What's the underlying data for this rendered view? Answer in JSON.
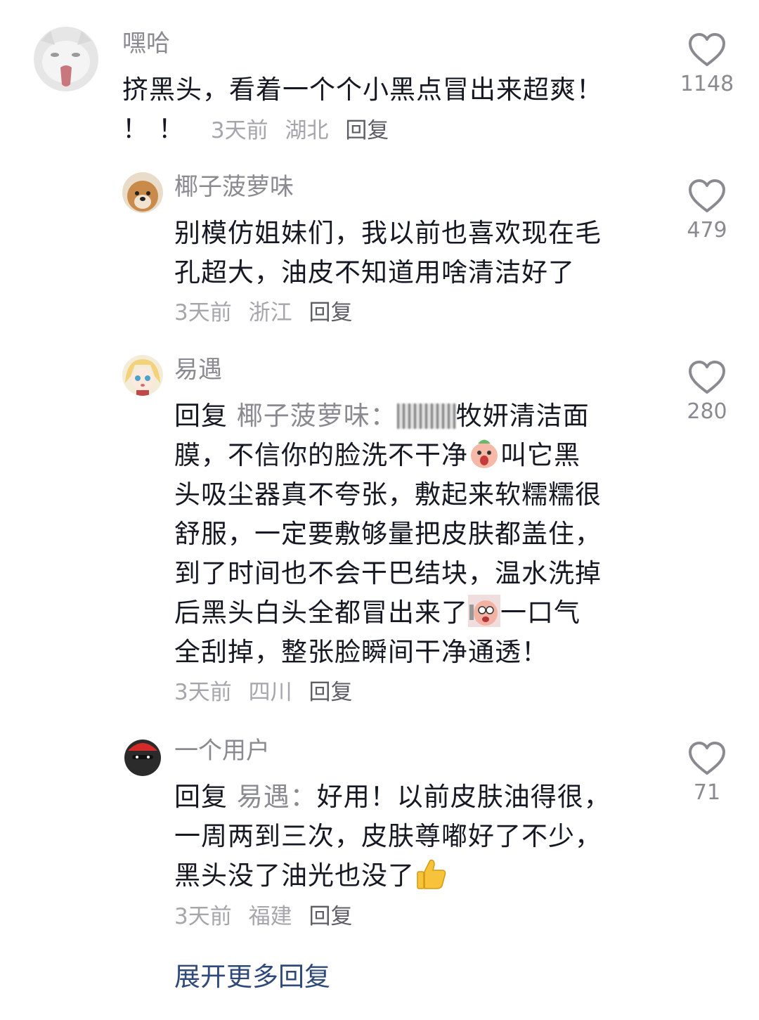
{
  "comments": [
    {
      "username": "嘿哈",
      "avatar_icon": "cat-avatar-icon",
      "lines": [
        "挤黑头，看着一个个小黑点冒出来超爽！"
      ],
      "tail": "！！",
      "time": "3天前",
      "region": "湖北",
      "reply_label": "回复",
      "likes": "1148"
    },
    {
      "username": "椰子菠萝味",
      "avatar_icon": "dog-avatar-icon",
      "lines": [
        "别模仿姐妹们，我以前也喜欢现在毛",
        "孔超大，油皮不知道用啥清洁好了"
      ],
      "time": "3天前",
      "region": "浙江",
      "reply_label": "回复",
      "likes": "479"
    },
    {
      "username": "易遇",
      "avatar_icon": "anime-girl-avatar-icon",
      "reply_prefix": "回复",
      "reply_to": "椰子菠萝味：",
      "line1_tail": "牧妍清洁面",
      "line2_a": "膜，不信你的脸洗不干净",
      "line2_b": "叫它黑",
      "line3": "头吸尘器真不夸张，敷起来软糯糯很",
      "line4": "舒服，一定要敷够量把皮肤都盖住，",
      "line5": "到了时间也不会干巴结块，温水洗掉",
      "line6_a": "后黑头白头全都冒出来了",
      "line6_b": "一口气",
      "line7": "全刮掉，整张脸瞬间干净通透！",
      "time": "3天前",
      "region": "四川",
      "reply_label": "回复",
      "likes": "280"
    },
    {
      "username": "一个用户",
      "avatar_icon": "ninja-avatar-icon",
      "reply_prefix": "回复",
      "reply_to": "易遇：",
      "line1_tail": "好用！以前皮肤油得很，",
      "line2": "一周两到三次，皮肤尊嘟好了不少，",
      "line3": "黑头没了油光也没了",
      "time": "3天前",
      "region": "福建",
      "reply_label": "回复",
      "likes": "71"
    }
  ],
  "expand_more": "展开更多回复",
  "colors": {
    "text": "#161823",
    "secondary": "#8a8b91",
    "meta": "#a5a6ab",
    "link": "#2f4a7a"
  }
}
